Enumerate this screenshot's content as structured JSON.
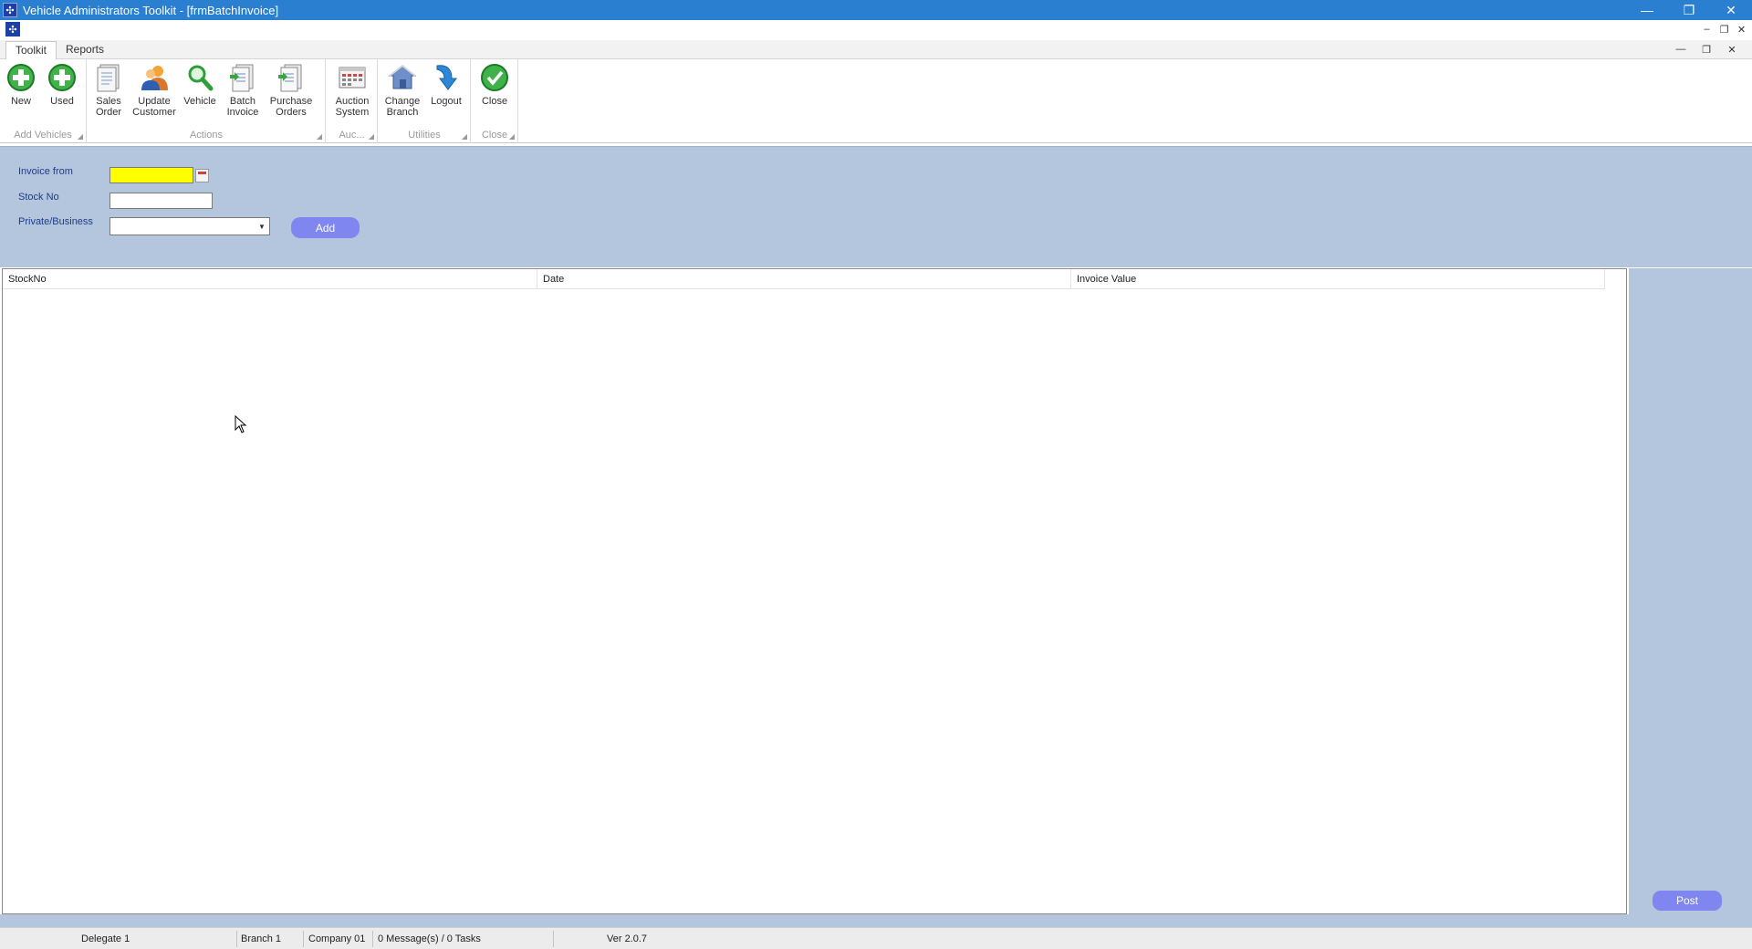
{
  "window": {
    "title": "Vehicle Administrators Toolkit - [frmBatchInvoice]",
    "minimize": "—",
    "restore": "❐",
    "close": "✕"
  },
  "mdi": {
    "minimize": "–",
    "restore": "❐",
    "close": "✕"
  },
  "ribbon_tabs": [
    {
      "label": "Toolkit",
      "active": true
    },
    {
      "label": "Reports",
      "active": false
    }
  ],
  "ribbon_inner": {
    "minimize": "—",
    "restore": "❐",
    "close": "✕"
  },
  "ribbon": {
    "groups": [
      {
        "label": "Add Vehicles"
      },
      {
        "label": "Actions"
      },
      {
        "label": "Auc..."
      },
      {
        "label": "Utilities"
      },
      {
        "label": "Close"
      }
    ],
    "buttons": {
      "new": "New",
      "used": "Used",
      "sales_order": "Sales\nOrder",
      "update_customer": "Update\nCustomer",
      "vehicle": "Vehicle",
      "batch_invoice": "Batch\nInvoice",
      "purchase_orders": "Purchase\nOrders",
      "auction_system": "Auction\nSystem",
      "change_branch": "Change\nBranch",
      "logout": "Logout",
      "close": "Close"
    }
  },
  "form": {
    "invoice_from_label": "Invoice from",
    "invoice_from_value": "",
    "stock_no_label": "Stock No",
    "stock_no_value": "",
    "private_business_label": "Private/Business",
    "private_business_value": "",
    "add_label": "Add"
  },
  "grid": {
    "columns": [
      "StockNo",
      "Date",
      "Invoice Value"
    ],
    "rows": []
  },
  "post_label": "Post",
  "status": {
    "delegate": "Delegate 1",
    "branch": "Branch 1",
    "company": "Company 01",
    "messages": "0 Message(s) / 0 Tasks",
    "version": "Ver 2.0.7"
  },
  "colors": {
    "titlebar": "#2b7fd0",
    "panel": "#b4c6de",
    "button": "#7f86f0",
    "date_highlight": "#ffff00"
  }
}
